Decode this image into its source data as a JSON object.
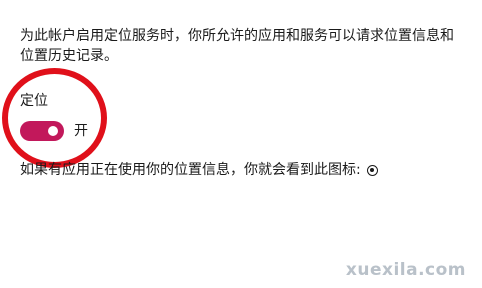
{
  "description": "为此帐户启用定位服务时，你所允许的应用和服务可以请求位置信息和位置历史记录。",
  "location_section": {
    "label": "定位",
    "toggle": {
      "state_label": "开",
      "on": true,
      "color": "#c2185b"
    }
  },
  "info_text": "如果有应用正在使用你的位置信息，你就会看到此图标:",
  "info_icon": "location-in-use-icon",
  "annotation_color": "#e0101a",
  "watermark": "xuexila.com"
}
